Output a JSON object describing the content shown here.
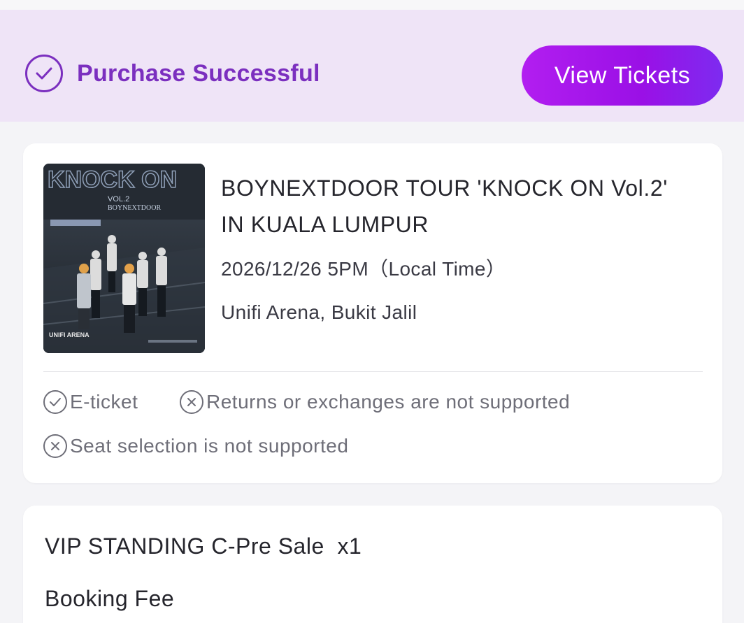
{
  "banner": {
    "status_text": "Purchase Successful",
    "button_label": "View Tickets",
    "status_icon": "check-circle-icon",
    "accent_color": "#7b2fbf"
  },
  "event": {
    "poster": {
      "title_text": "KNOCK ON",
      "vol_text": "VOL.2",
      "artist_text": "BOYNEXTDOOR",
      "venue_text": "UNIFI ARENA"
    },
    "title": "BOYNEXTDOOR TOUR 'KNOCK ON Vol.2' IN KUALA LUMPUR",
    "datetime": "2026/12/26 5PM（Local Time）",
    "venue": "Unifi Arena, Bukit Jalil",
    "notes": [
      {
        "icon": "check-circle-icon",
        "text": "E-ticket"
      },
      {
        "icon": "x-circle-icon",
        "text": "Returns or exchanges are not supported"
      },
      {
        "icon": "x-circle-icon",
        "text": "Seat selection is not supported"
      }
    ]
  },
  "ticket": {
    "name": "VIP STANDING C-Pre Sale  x1",
    "fee_label": "Booking Fee"
  }
}
